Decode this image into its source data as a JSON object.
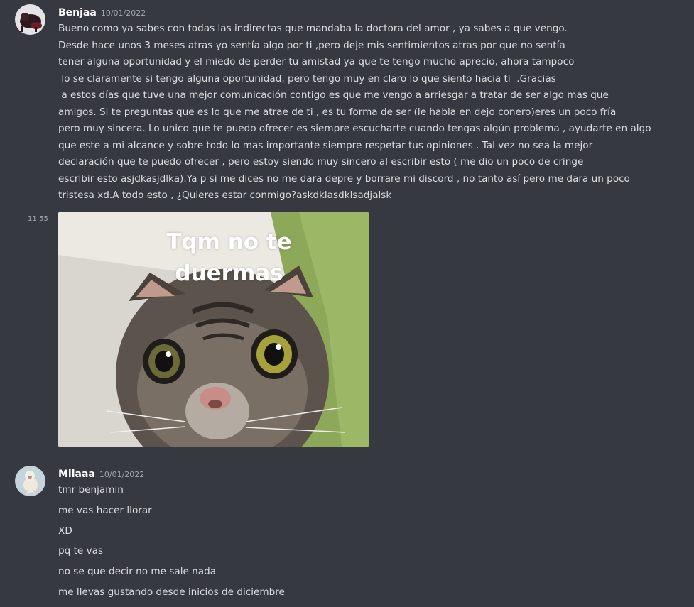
{
  "messages": [
    {
      "author": "Benjaa",
      "timestamp": "10/01/2022",
      "lines": [
        "Bueno como ya sabes con todas las indirectas que mandaba la doctora del amor , ya sabes a que vengo.",
        "Desde hace unos 3 meses atras yo sentía algo por ti ,pero deje mis sentimientos atras por que no sentía",
        "tener alguna oportunidad y el miedo de perder tu amistad ya que te tengo mucho aprecio, ahora tampoco",
        " lo se claramente si tengo alguna oportunidad, pero tengo muy en claro lo que siento hacia ti  .Gracias",
        " a estos días que tuve una mejor comunicación contigo es que me vengo a arriesgar a tratar de ser algo mas que",
        "amigos. Si te preguntas que es lo que me atrae de ti , es tu forma de ser (le habla en dejo conero)eres un poco fría",
        "pero muy sincera. Lo unico que te puedo ofrecer es siempre escucharte cuando tengas algún problema , ayudarte en algo",
        "que este a mi alcance y sobre todo lo mas importante siempre respetar tus opiniones . Tal vez no sea la mejor",
        "declaración que te puedo ofrecer , pero estoy siendo muy sincero al escribir esto ( me dio un poco de cringe",
        "escribir esto asjdkasjdlka).Ya p si me dices no me dara depre y borrare mi discord , no tanto así pero me dara un poco",
        "tristesa xd.A todo esto , ¿Quieres estar conmigo?askdklasdklsadjalsk"
      ]
    },
    {
      "side_time": "11:55",
      "attachment": {
        "caption_line1": "Tqm no te",
        "caption_line2": "duermas"
      }
    },
    {
      "author": "Milaaa",
      "timestamp": "10/01/2022",
      "lines": [
        "tmr benjamin",
        "me vas hacer llorar",
        "XD",
        "pq te vas",
        "no se que decir no me sale nada",
        "me llevas gustando desde inicios de diciembre"
      ]
    }
  ],
  "colors": {
    "background": "#36393f",
    "text": "#dcddde",
    "username": "#ffffff",
    "timestamp": "#a3a6aa"
  }
}
